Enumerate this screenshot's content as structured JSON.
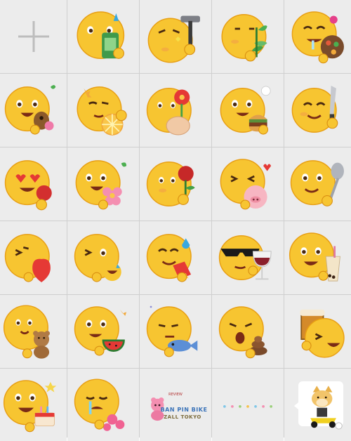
{
  "panel": {
    "add_icon": "plus-icon",
    "stickers": [
      {
        "row": 1,
        "col": 2,
        "icon": "emoji-eating-cake-icon"
      },
      {
        "row": 1,
        "col": 3,
        "icon": "emoji-hammer-icon"
      },
      {
        "row": 1,
        "col": 4,
        "icon": "emoji-plant-icon"
      },
      {
        "row": 1,
        "col": 5,
        "icon": "emoji-drooling-food-icon"
      },
      {
        "row": 2,
        "col": 1,
        "icon": "emoji-horse-icon"
      },
      {
        "row": 2,
        "col": 2,
        "icon": "emoji-lemon-icon"
      },
      {
        "row": 2,
        "col": 3,
        "icon": "emoji-flower-icon"
      },
      {
        "row": 2,
        "col": 4,
        "icon": "emoji-burger-icon"
      },
      {
        "row": 2,
        "col": 5,
        "icon": "emoji-knife-icon"
      },
      {
        "row": 3,
        "col": 1,
        "icon": "emoji-heart-eyes-rose-icon"
      },
      {
        "row": 3,
        "col": 2,
        "icon": "emoji-pink-flower-icon"
      },
      {
        "row": 3,
        "col": 3,
        "icon": "emoji-rose-icon"
      },
      {
        "row": 3,
        "col": 4,
        "icon": "emoji-pig-icon"
      },
      {
        "row": 3,
        "col": 5,
        "icon": "emoji-spoon-icon"
      },
      {
        "row": 4,
        "col": 1,
        "icon": "emoji-heart-icon"
      },
      {
        "row": 4,
        "col": 2,
        "icon": "emoji-laughing-icon"
      },
      {
        "row": 4,
        "col": 3,
        "icon": "emoji-sweat-icon"
      },
      {
        "row": 4,
        "col": 4,
        "icon": "emoji-sunglasses-wine-icon"
      },
      {
        "row": 4,
        "col": 5,
        "icon": "emoji-bubble-tea-icon"
      },
      {
        "row": 5,
        "col": 1,
        "icon": "emoji-teddy-bear-icon"
      },
      {
        "row": 5,
        "col": 2,
        "icon": "emoji-watermelon-icon"
      },
      {
        "row": 5,
        "col": 3,
        "icon": "emoji-fish-icon"
      },
      {
        "row": 5,
        "col": 4,
        "icon": "emoji-poop-icon"
      },
      {
        "row": 5,
        "col": 5,
        "icon": "emoji-beer-icon"
      },
      {
        "row": 6,
        "col": 1,
        "icon": "emoji-cake-icon"
      },
      {
        "row": 6,
        "col": 2,
        "icon": "emoji-crying-flowers-icon"
      },
      {
        "row": 6,
        "col": 3,
        "icon": "sticker-pink-bear-icon"
      },
      {
        "row": 6,
        "col": 4,
        "icon": "sticker-dots-icon"
      },
      {
        "row": 6,
        "col": 5,
        "icon": "sticker-doge-scooter-icon"
      }
    ],
    "bear_sticker_text": "BAN PIN  BIKE",
    "bear_sticker_sub": "REVIEW",
    "bear_sticker_tag": "ZALL TOKYO",
    "colors": {
      "face": "#f7c531",
      "background": "#ececec",
      "divider": "#cfcfcf"
    }
  }
}
